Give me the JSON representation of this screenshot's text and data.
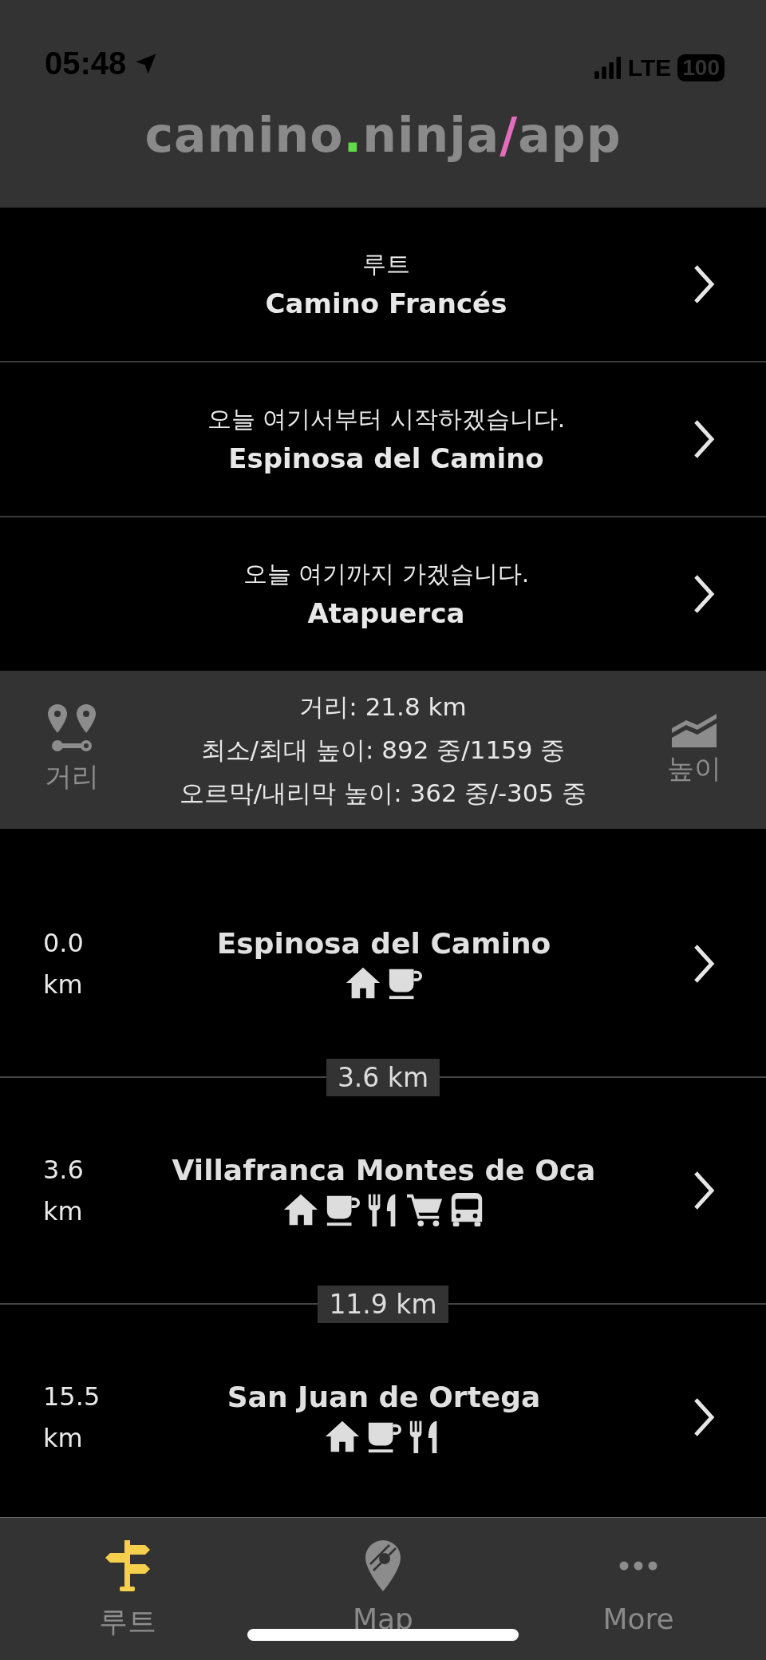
{
  "status_bar": {
    "time": "05:48",
    "network": "LTE",
    "battery": "100"
  },
  "header": {
    "title_parts": [
      {
        "text": "camino",
        "color": "#8a8a8a"
      },
      {
        "text": ".",
        "color": "#5fdc45"
      },
      {
        "text": "ninja",
        "color": "#8a8a8a"
      },
      {
        "text": "/",
        "color": "#e46cbd"
      },
      {
        "text": "app",
        "color": "#8a8a8a"
      }
    ]
  },
  "settings": [
    {
      "label": "루트",
      "value": "Camino Francés"
    },
    {
      "label": "오늘 여기서부터 시작하겠습니다.",
      "value": "Espinosa del Camino"
    },
    {
      "label": "오늘 여기까지 가겠습니다.",
      "value": "Atapuerca"
    }
  ],
  "summary": {
    "left_label": "거리",
    "lines": [
      "거리: 21.8 km",
      "최소/최대 높이: 892 중/1159 중",
      "오르막/내리막 높이: 362 중/-305 중"
    ],
    "right_label": "높이"
  },
  "stops": [
    {
      "distance": "0.0 km",
      "name": "Espinosa del Camino",
      "amenities": [
        {
          "kind": "lodging"
        },
        {
          "kind": "cafe"
        }
      ],
      "next_segment": "3.6 km"
    },
    {
      "distance": "3.6 km",
      "name": "Villafranca Montes de Oca",
      "amenities": [
        {
          "kind": "lodging"
        },
        {
          "kind": "cafe"
        },
        {
          "kind": "restaurant"
        },
        {
          "kind": "shop"
        },
        {
          "kind": "bus"
        }
      ],
      "next_segment": "11.9 km"
    },
    {
      "distance": "15.5 km",
      "name": "San Juan de Ortega",
      "amenities": [
        {
          "kind": "lodging"
        },
        {
          "kind": "cafe"
        },
        {
          "kind": "restaurant"
        }
      ]
    }
  ],
  "tabs": [
    {
      "label": "루트",
      "selected": true
    },
    {
      "label": "Map",
      "selected": false
    },
    {
      "label": "More",
      "selected": false
    }
  ]
}
